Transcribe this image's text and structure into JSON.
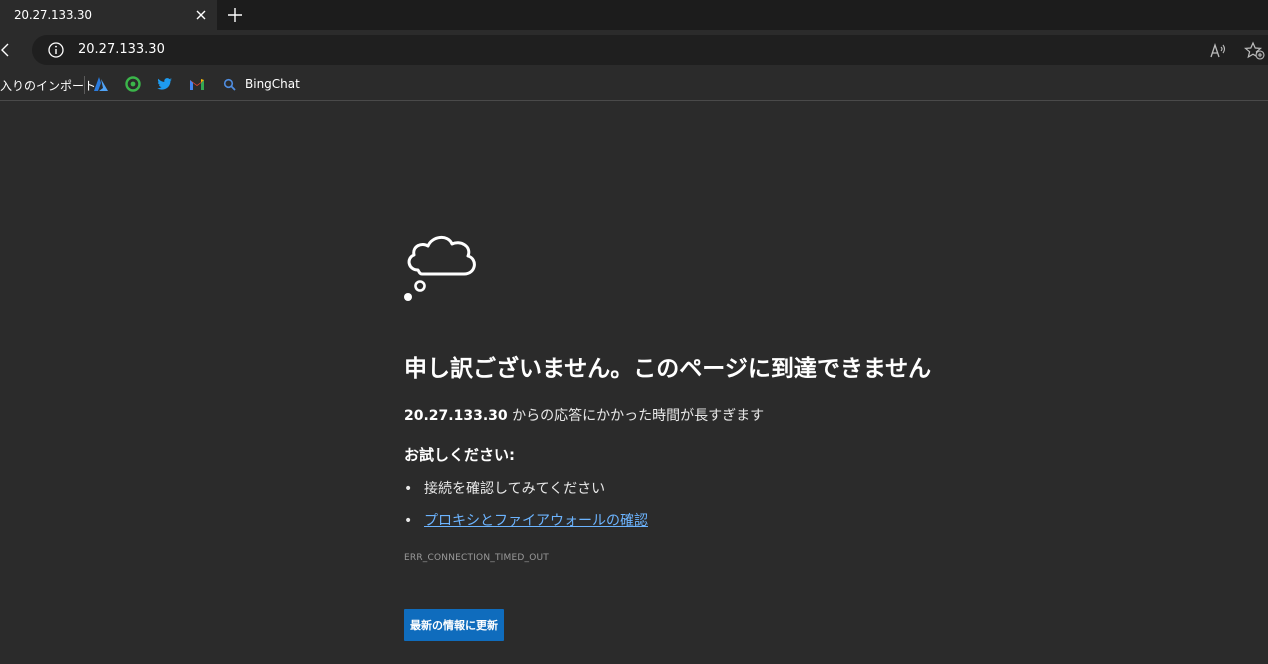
{
  "tab": {
    "title": "20.27.133.30"
  },
  "address_bar": {
    "url": "20.27.133.30"
  },
  "favorites_bar": {
    "import_label": "入りのインポート",
    "items": [
      {
        "name": "azure-icon",
        "color": "#2a7bde"
      },
      {
        "name": "green-refresh-icon",
        "color": "#3bb54a"
      },
      {
        "name": "twitter-icon",
        "color": "#1d9bf0"
      },
      {
        "name": "gmail-icon",
        "color": "#ea4335"
      }
    ],
    "bing_label": "BingChat"
  },
  "error_page": {
    "title": "申し訳ございません。このページに到達できません",
    "host": "20.27.133.30",
    "description_suffix": " からの応答にかかった時間が長すぎます",
    "try_heading": "お試しください:",
    "suggestions": [
      {
        "text": "接続を確認してみてください",
        "is_link": false
      },
      {
        "text": "プロキシとファイアウォールの確認",
        "is_link": true
      }
    ],
    "bullet": "•",
    "error_code": "ERR_CONNECTION_TIMED_OUT",
    "reload_button": "最新の情報に更新"
  },
  "colors": {
    "background": "#2b2b2b",
    "link": "#6cb4ff",
    "button": "#0f6cbd"
  }
}
